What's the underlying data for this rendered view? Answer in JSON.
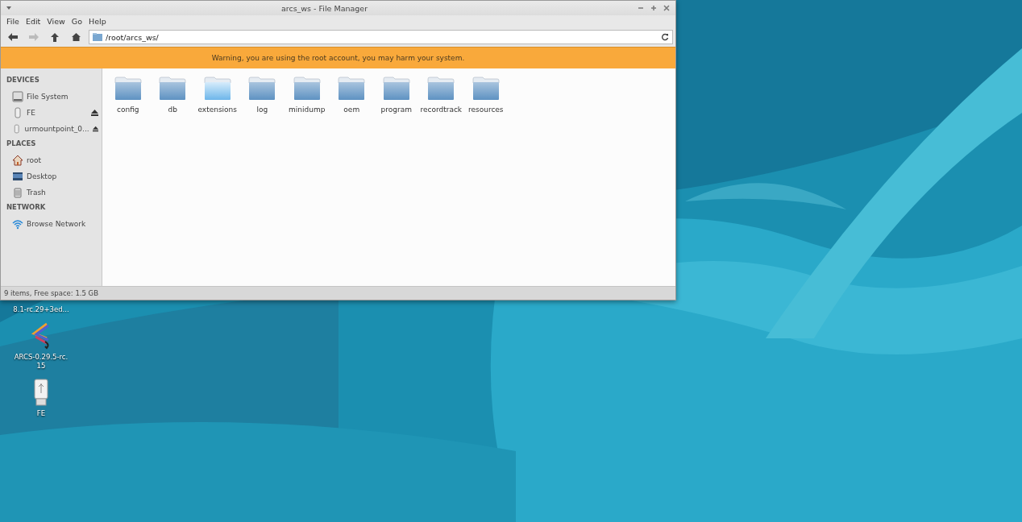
{
  "window": {
    "title": "arcs_ws - File Manager"
  },
  "menu": [
    "File",
    "Edit",
    "View",
    "Go",
    "Help"
  ],
  "toolbar": {
    "back_disabled": false,
    "forward_disabled": true,
    "path": "/root/arcs_ws/"
  },
  "warning": "Warning, you are using the root account, you may harm your system.",
  "sidebar": [
    {
      "heading": "DEVICES",
      "items": [
        {
          "kind": "drive",
          "label": "File System",
          "ejectable": false
        },
        {
          "kind": "usb",
          "label": "FE",
          "ejectable": true
        },
        {
          "kind": "usb",
          "label": "urmountpoint_0...",
          "ejectable": true
        }
      ]
    },
    {
      "heading": "PLACES",
      "items": [
        {
          "kind": "home",
          "label": "root",
          "ejectable": false
        },
        {
          "kind": "desktop",
          "label": "Desktop",
          "ejectable": false
        },
        {
          "kind": "trash",
          "label": "Trash",
          "ejectable": false
        }
      ]
    },
    {
      "heading": "NETWORK",
      "items": [
        {
          "kind": "network",
          "label": "Browse Network",
          "ejectable": false
        }
      ]
    }
  ],
  "folders": [
    {
      "name": "config",
      "highlighted": false
    },
    {
      "name": "db",
      "highlighted": false
    },
    {
      "name": "extensions",
      "highlighted": true
    },
    {
      "name": "log",
      "highlighted": false
    },
    {
      "name": "minidump",
      "highlighted": false
    },
    {
      "name": "oem",
      "highlighted": false
    },
    {
      "name": "program",
      "highlighted": false
    },
    {
      "name": "recordtrack",
      "highlighted": false
    },
    {
      "name": "resources",
      "highlighted": false
    }
  ],
  "status_bar": "9 items, Free space: 1.5 GB",
  "desktop_icons": [
    {
      "kind": "hidden",
      "label": "8.1-rc.29+3ed..."
    },
    {
      "kind": "app",
      "label": "ARCS-0.29.5-rc.15"
    },
    {
      "kind": "usb",
      "label": "FE"
    }
  ]
}
